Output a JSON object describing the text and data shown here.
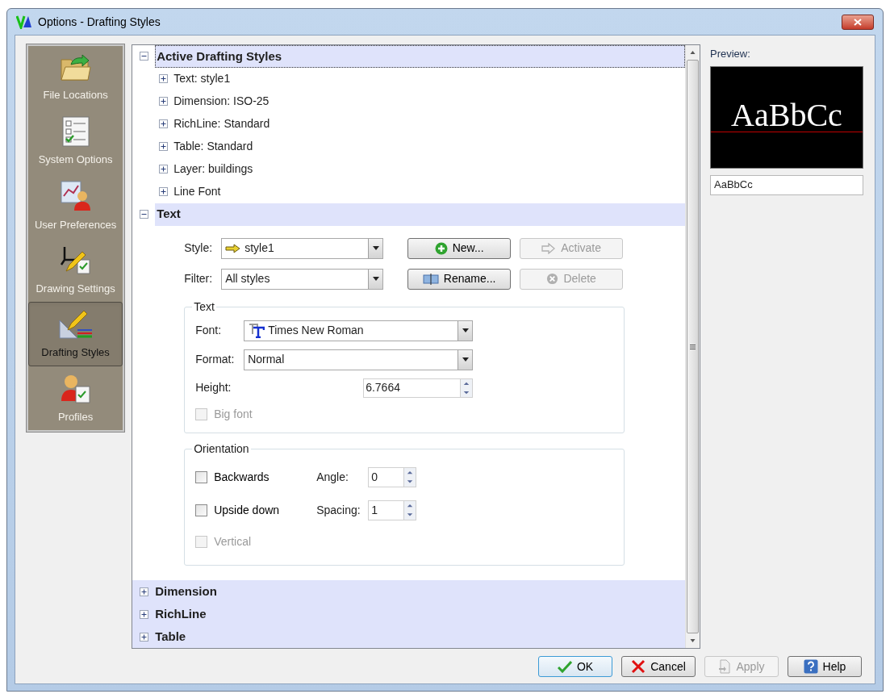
{
  "window": {
    "title": "Options - Drafting Styles"
  },
  "sidebar": {
    "items": [
      {
        "label": "File Locations",
        "kind": "folder",
        "selected": false
      },
      {
        "label": "System Options",
        "kind": "checklist",
        "selected": false
      },
      {
        "label": "User Preferences",
        "kind": "user",
        "selected": false
      },
      {
        "label": "Drawing Settings",
        "kind": "drawing",
        "selected": false
      },
      {
        "label": "Drafting Styles",
        "kind": "drafting",
        "selected": true
      },
      {
        "label": "Profiles",
        "kind": "profiles",
        "selected": false
      }
    ]
  },
  "tree": {
    "active_styles": {
      "label": "Active Drafting Styles",
      "expanded": true,
      "children": [
        {
          "label": "Text: style1",
          "expanded": false
        },
        {
          "label": "Dimension: ISO-25",
          "expanded": false
        },
        {
          "label": "RichLine: Standard",
          "expanded": false
        },
        {
          "label": "Table: Standard",
          "expanded": false
        },
        {
          "label": "Layer: buildings",
          "expanded": false
        },
        {
          "label": "Line Font",
          "expanded": false
        }
      ]
    },
    "text_section": {
      "label": "Text",
      "expanded": true
    },
    "text_panel": {
      "style": {
        "label": "Style:",
        "value": "style1"
      },
      "filter": {
        "label": "Filter:",
        "value": "All styles"
      },
      "buttons": [
        {
          "label": "New...",
          "kind": "new",
          "disabled": false
        },
        {
          "label": "Activate",
          "kind": "activate",
          "disabled": true
        },
        {
          "label": "Rename...",
          "kind": "rename",
          "disabled": false
        },
        {
          "label": "Delete",
          "kind": "delete",
          "disabled": true
        }
      ],
      "text_group": {
        "title": "Text",
        "font": {
          "label": "Font:",
          "value": "Times New Roman"
        },
        "format": {
          "label": "Format:",
          "value": "Normal"
        },
        "height": {
          "label": "Height:",
          "value": "6.7664"
        },
        "big_font": {
          "label": "Big font",
          "checked": false,
          "disabled": true
        }
      },
      "orientation": {
        "title": "Orientation",
        "backwards": {
          "label": "Backwards",
          "checked": false,
          "disabled": false
        },
        "angle": {
          "label": "Angle:",
          "value": "0"
        },
        "upside_down": {
          "label": "Upside down",
          "checked": false,
          "disabled": false
        },
        "spacing": {
          "label": "Spacing:",
          "value": "1"
        },
        "vertical": {
          "label": "Vertical",
          "checked": false,
          "disabled": true
        }
      }
    },
    "collapsed_sections": [
      {
        "label": "Dimension",
        "expanded": false
      },
      {
        "label": "RichLine",
        "expanded": false
      },
      {
        "label": "Table",
        "expanded": false
      }
    ]
  },
  "preview": {
    "label": "Preview:",
    "sample": "AaBbCc",
    "field_value": "AaBbCc"
  },
  "footer_buttons": [
    {
      "label": "OK",
      "kind": "ok",
      "disabled": false
    },
    {
      "label": "Cancel",
      "kind": "cancel",
      "disabled": false
    },
    {
      "label": "Apply",
      "kind": "apply",
      "disabled": true
    },
    {
      "label": "Help",
      "kind": "help",
      "disabled": false
    }
  ]
}
